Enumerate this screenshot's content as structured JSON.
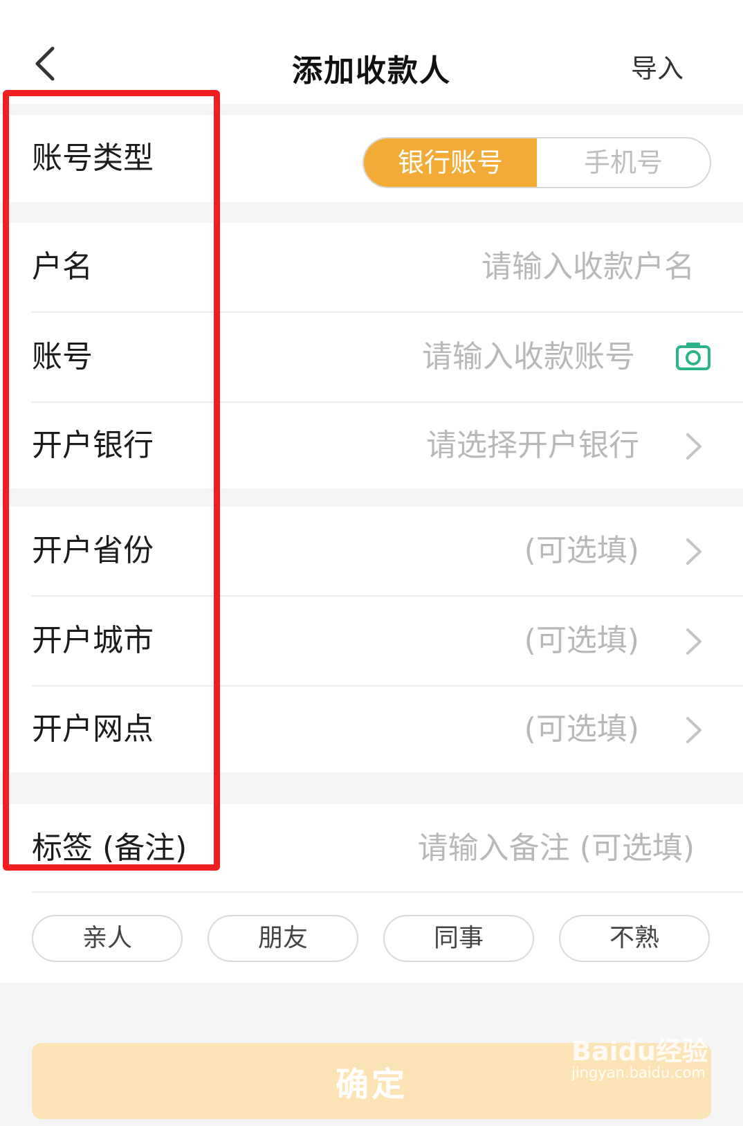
{
  "header": {
    "title": "添加收款人",
    "import_label": "导入"
  },
  "account_type": {
    "label": "账号类型",
    "options": [
      "银行账号",
      "手机号"
    ],
    "selected": "银行账号"
  },
  "fields": {
    "name": {
      "label": "户名",
      "placeholder": "请输入收款户名"
    },
    "account": {
      "label": "账号",
      "placeholder": "请输入收款账号"
    },
    "bank": {
      "label": "开户银行",
      "placeholder": "请选择开户银行"
    },
    "province": {
      "label": "开户省份",
      "placeholder": "(可选填)"
    },
    "city": {
      "label": "开户城市",
      "placeholder": "(可选填)"
    },
    "branch": {
      "label": "开户网点",
      "placeholder": "(可选填)"
    },
    "tag": {
      "label": "标签 (备注)",
      "placeholder": "请输入备注 (可选填)"
    }
  },
  "tags": [
    "亲人",
    "朋友",
    "同事",
    "不熟"
  ],
  "confirm_label": "确定",
  "watermark": {
    "logo": "Baidu经验",
    "url": "jingyan.baidu.com"
  },
  "colors": {
    "accent": "#f3ab37",
    "camera": "#2bb38a",
    "annotation": "#f01e1e"
  }
}
